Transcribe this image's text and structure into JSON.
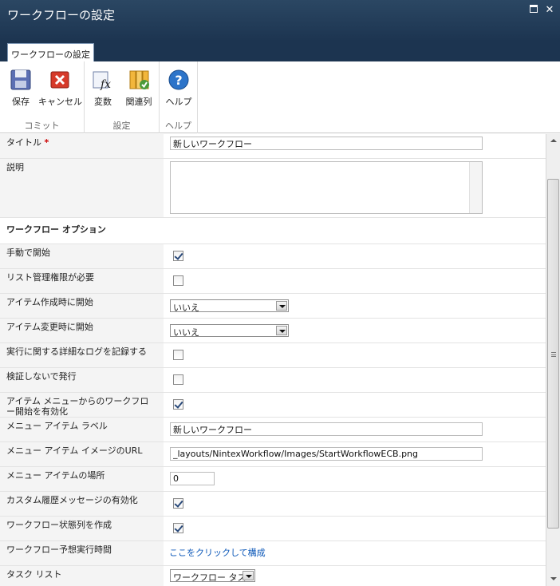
{
  "window": {
    "title": "ワークフローの設定"
  },
  "ribbon": {
    "tab": "ワークフローの設定",
    "groups": [
      {
        "label": "コミット",
        "buttons": [
          "保存",
          "キャンセル"
        ]
      },
      {
        "label": "設定",
        "buttons": [
          "変数",
          "関連列"
        ]
      },
      {
        "label": "ヘルプ",
        "buttons": [
          "ヘルプ"
        ]
      }
    ]
  },
  "form": {
    "title_label": "タイトル",
    "required_mark": "*",
    "title_value": "新しいワークフロー",
    "description_label": "説明",
    "section_options": "ワークフロー オプション",
    "manual_start_label": "手動で開始",
    "manual_start_checked": true,
    "require_manage_label": "リスト管理権限が必要",
    "require_manage_checked": false,
    "start_on_create_label": "アイテム作成時に開始",
    "start_on_create_value": "いいえ",
    "start_on_change_label": "アイテム変更時に開始",
    "start_on_change_value": "いいえ",
    "verbose_log_label": "実行に関する詳細なログを記録する",
    "verbose_log_checked": false,
    "publish_no_validate_label": "検証しないで発行",
    "publish_no_validate_checked": false,
    "ecb_enable_label": "アイテム メニューからのワークフロー開始を有効化",
    "ecb_enable_checked": true,
    "menu_item_label_label": "メニュー アイテム ラベル",
    "menu_item_label_value": "新しいワークフロー",
    "menu_item_image_label": "メニュー アイテム イメージのURL",
    "menu_item_image_value": "_layouts/NintexWorkflow/Images/StartWorkflowECB.png",
    "menu_item_pos_label": "メニュー アイテムの場所",
    "menu_item_pos_value": "0",
    "custom_history_label": "カスタム履歴メッセージの有効化",
    "custom_history_checked": true,
    "status_column_label": "ワークフロー状態列を作成",
    "status_column_checked": true,
    "estimated_time_label": "ワークフロー予想実行時間",
    "estimated_time_link": "ここをクリックして構成",
    "task_list_label": "タスク リスト",
    "task_list_value": "ワークフロー タスク"
  }
}
